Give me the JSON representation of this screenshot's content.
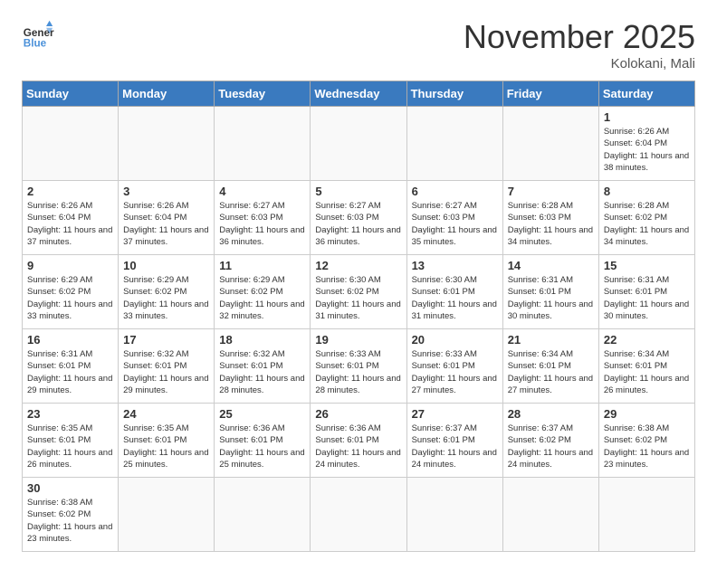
{
  "header": {
    "logo_general": "General",
    "logo_blue": "Blue",
    "title": "November 2025",
    "location": "Kolokani, Mali"
  },
  "days_of_week": [
    "Sunday",
    "Monday",
    "Tuesday",
    "Wednesday",
    "Thursday",
    "Friday",
    "Saturday"
  ],
  "weeks": [
    [
      {
        "day": "",
        "info": ""
      },
      {
        "day": "",
        "info": ""
      },
      {
        "day": "",
        "info": ""
      },
      {
        "day": "",
        "info": ""
      },
      {
        "day": "",
        "info": ""
      },
      {
        "day": "",
        "info": ""
      },
      {
        "day": "1",
        "info": "Sunrise: 6:26 AM\nSunset: 6:04 PM\nDaylight: 11 hours and 38 minutes."
      }
    ],
    [
      {
        "day": "2",
        "info": "Sunrise: 6:26 AM\nSunset: 6:04 PM\nDaylight: 11 hours and 37 minutes."
      },
      {
        "day": "3",
        "info": "Sunrise: 6:26 AM\nSunset: 6:04 PM\nDaylight: 11 hours and 37 minutes."
      },
      {
        "day": "4",
        "info": "Sunrise: 6:27 AM\nSunset: 6:03 PM\nDaylight: 11 hours and 36 minutes."
      },
      {
        "day": "5",
        "info": "Sunrise: 6:27 AM\nSunset: 6:03 PM\nDaylight: 11 hours and 36 minutes."
      },
      {
        "day": "6",
        "info": "Sunrise: 6:27 AM\nSunset: 6:03 PM\nDaylight: 11 hours and 35 minutes."
      },
      {
        "day": "7",
        "info": "Sunrise: 6:28 AM\nSunset: 6:03 PM\nDaylight: 11 hours and 34 minutes."
      },
      {
        "day": "8",
        "info": "Sunrise: 6:28 AM\nSunset: 6:02 PM\nDaylight: 11 hours and 34 minutes."
      }
    ],
    [
      {
        "day": "9",
        "info": "Sunrise: 6:29 AM\nSunset: 6:02 PM\nDaylight: 11 hours and 33 minutes."
      },
      {
        "day": "10",
        "info": "Sunrise: 6:29 AM\nSunset: 6:02 PM\nDaylight: 11 hours and 33 minutes."
      },
      {
        "day": "11",
        "info": "Sunrise: 6:29 AM\nSunset: 6:02 PM\nDaylight: 11 hours and 32 minutes."
      },
      {
        "day": "12",
        "info": "Sunrise: 6:30 AM\nSunset: 6:02 PM\nDaylight: 11 hours and 31 minutes."
      },
      {
        "day": "13",
        "info": "Sunrise: 6:30 AM\nSunset: 6:01 PM\nDaylight: 11 hours and 31 minutes."
      },
      {
        "day": "14",
        "info": "Sunrise: 6:31 AM\nSunset: 6:01 PM\nDaylight: 11 hours and 30 minutes."
      },
      {
        "day": "15",
        "info": "Sunrise: 6:31 AM\nSunset: 6:01 PM\nDaylight: 11 hours and 30 minutes."
      }
    ],
    [
      {
        "day": "16",
        "info": "Sunrise: 6:31 AM\nSunset: 6:01 PM\nDaylight: 11 hours and 29 minutes."
      },
      {
        "day": "17",
        "info": "Sunrise: 6:32 AM\nSunset: 6:01 PM\nDaylight: 11 hours and 29 minutes."
      },
      {
        "day": "18",
        "info": "Sunrise: 6:32 AM\nSunset: 6:01 PM\nDaylight: 11 hours and 28 minutes."
      },
      {
        "day": "19",
        "info": "Sunrise: 6:33 AM\nSunset: 6:01 PM\nDaylight: 11 hours and 28 minutes."
      },
      {
        "day": "20",
        "info": "Sunrise: 6:33 AM\nSunset: 6:01 PM\nDaylight: 11 hours and 27 minutes."
      },
      {
        "day": "21",
        "info": "Sunrise: 6:34 AM\nSunset: 6:01 PM\nDaylight: 11 hours and 27 minutes."
      },
      {
        "day": "22",
        "info": "Sunrise: 6:34 AM\nSunset: 6:01 PM\nDaylight: 11 hours and 26 minutes."
      }
    ],
    [
      {
        "day": "23",
        "info": "Sunrise: 6:35 AM\nSunset: 6:01 PM\nDaylight: 11 hours and 26 minutes."
      },
      {
        "day": "24",
        "info": "Sunrise: 6:35 AM\nSunset: 6:01 PM\nDaylight: 11 hours and 25 minutes."
      },
      {
        "day": "25",
        "info": "Sunrise: 6:36 AM\nSunset: 6:01 PM\nDaylight: 11 hours and 25 minutes."
      },
      {
        "day": "26",
        "info": "Sunrise: 6:36 AM\nSunset: 6:01 PM\nDaylight: 11 hours and 24 minutes."
      },
      {
        "day": "27",
        "info": "Sunrise: 6:37 AM\nSunset: 6:01 PM\nDaylight: 11 hours and 24 minutes."
      },
      {
        "day": "28",
        "info": "Sunrise: 6:37 AM\nSunset: 6:02 PM\nDaylight: 11 hours and 24 minutes."
      },
      {
        "day": "29",
        "info": "Sunrise: 6:38 AM\nSunset: 6:02 PM\nDaylight: 11 hours and 23 minutes."
      }
    ],
    [
      {
        "day": "30",
        "info": "Sunrise: 6:38 AM\nSunset: 6:02 PM\nDaylight: 11 hours and 23 minutes."
      },
      {
        "day": "",
        "info": ""
      },
      {
        "day": "",
        "info": ""
      },
      {
        "day": "",
        "info": ""
      },
      {
        "day": "",
        "info": ""
      },
      {
        "day": "",
        "info": ""
      },
      {
        "day": "",
        "info": ""
      }
    ]
  ]
}
